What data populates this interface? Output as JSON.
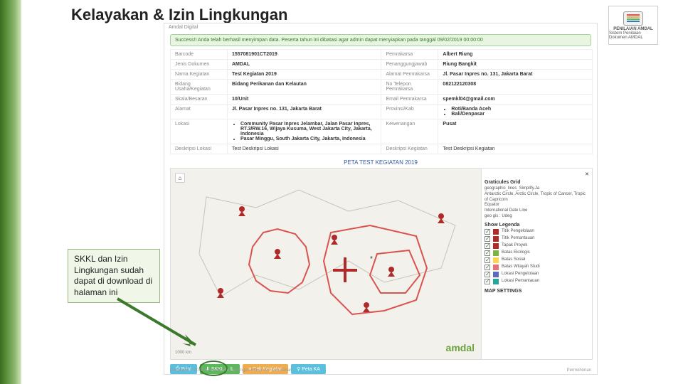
{
  "page": {
    "title": "Kelayakan & Izin Lingkungan"
  },
  "logo": {
    "caption": "PENILAIAN AMDAL",
    "sub": "Sistem Penilaian Dokumen AMDAL",
    "bars": [
      "#d9534f",
      "#f0ad4e",
      "#5cb85c",
      "#337ab7"
    ]
  },
  "callout": {
    "text": "SKKL dan Izin Lingkungan sudah dapat di download di halaman ini"
  },
  "shot": {
    "header": "Amdal Digital",
    "success": "Success!! Anda telah berhasil menyimpan data. Peserta tahun ini dibatasi agar admin dapat menyiapkan pada tanggal 09/02/2019 00:00:00",
    "rows": [
      {
        "l1": "Barcode",
        "v1": "1557081901CT2019",
        "l2": "Pemrakarsa",
        "v2": "Albert Riung"
      },
      {
        "l1": "Jenis Dokumen",
        "v1": "AMDAL",
        "l2": "Penanggungjawab",
        "v2": "Riung Bangkit"
      },
      {
        "l1": "Nama Kegiatan",
        "v1": "Test Kegiatan 2019",
        "l2": "Alamat Pemrakarsa",
        "v2": "Jl. Pasar Inpres no. 131, Jakarta Barat"
      },
      {
        "l1": "Bidang Usaha/Kegiatan",
        "v1": "Bidang Perikanan dan Kelautan",
        "l2": "No Telepon Pemrakarsa",
        "v2": "082122120308"
      },
      {
        "l1": "Skala/Besaran",
        "v1": "10/Unit",
        "l2": "Email Pemrakarsa",
        "v2": "spemkl04@gmail.com"
      }
    ],
    "row_alamat": {
      "l": "Alamat",
      "v": "Jl. Pasar Inpres no. 131, Jakarta Barat",
      "l2": "Provinsi/Kab",
      "v2": [
        "Roti/Banda Aceh",
        "Bali/Denpasar"
      ]
    },
    "row_lokasi": {
      "l": "Lokasi",
      "v": [
        "Community Pasar Inpres Jelambar, Jalan Pasar Inpres, RT.3/RW.16, Wijaya Kusuma, West Jakarta City, Jakarta, Indonesia",
        "Pasar Minggu, South Jakarta City, Jakarta, Indonesia"
      ],
      "l2": "Kewenangan",
      "v2": "Pusat"
    },
    "row_desk": {
      "l": "Deskripsi Lokasi",
      "v": "Test Deskripsi Lokasi",
      "l2": "Deskripsi Kegiatan",
      "v2": "Test Deskripsi Kegiatan"
    },
    "map_title": "PETA TEST KEGIATAN 2019",
    "home_icon": "⌂",
    "panel": {
      "grat_h": "Graticules Grid",
      "grat_items": [
        "geographic_lines_Simplify.Ja",
        "Antarctic Circle, Arctic Circle, Tropic of Cancer, Tropic of Capricorn",
        "Equator",
        "International Date Line",
        "geo gis : Udeg"
      ],
      "leg_h": "Show Legenda",
      "settings": "MAP SETTINGS"
    },
    "legend": [
      {
        "color": "#b02a2a",
        "label": "Titik Pengelolaan"
      },
      {
        "color": "#b02a2a",
        "label": "Titik Pemantauan"
      },
      {
        "color": "#b02a2a",
        "label": "Tapak Proyek"
      },
      {
        "color": "#7cb342",
        "label": "Batas Ekologis"
      },
      {
        "color": "#ffd54f",
        "label": "Batas Sosial"
      },
      {
        "color": "#e57373",
        "label": "Batas Wilayah Studi"
      },
      {
        "color": "#5c6bc0",
        "label": "Lokasi Pengelolaan"
      },
      {
        "color": "#26a69a",
        "label": "Lokasi Pemantauan"
      }
    ],
    "watermark": "amdal",
    "scale": "1000 km",
    "buttons": [
      {
        "label": "Print",
        "color": "#5bc0de",
        "icon": "print-icon",
        "glyph": "⎙"
      },
      {
        "label": "SKKL & IL",
        "color": "#5cb85c",
        "icon": "download-icon",
        "glyph": "⬇"
      },
      {
        "label": "Cek Kegiatan",
        "color": "#f0ad4e",
        "icon": "list-icon",
        "glyph": "≡"
      },
      {
        "label": "Peta KA",
        "color": "#5bc0de",
        "icon": "map-icon",
        "glyph": "⚲"
      }
    ],
    "footer_l": "Copyright © 2018 Kementrian Lingkungan Hidup dan Kehutanan",
    "footer_r": "Permohonan"
  }
}
